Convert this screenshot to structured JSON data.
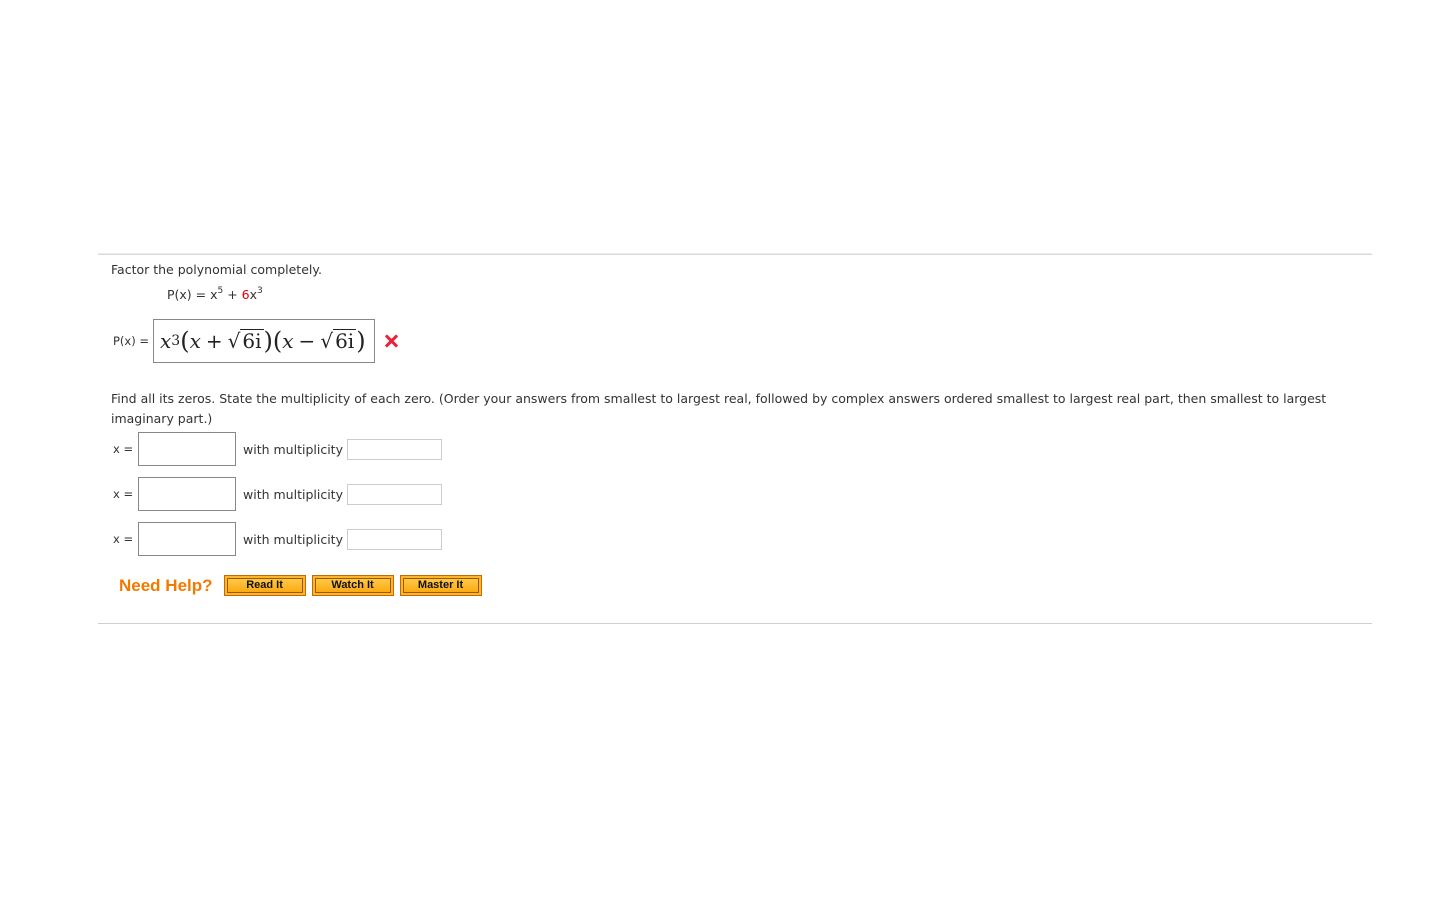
{
  "question": {
    "prompt": "Factor the polynomial completely.",
    "polynomial": {
      "lhs": "P(x) = x",
      "exp1": "5",
      "plus": " + ",
      "coef": "6",
      "var": "x",
      "exp2": "3"
    },
    "answer": {
      "label": "P(x) =",
      "x": "x",
      "x_exp": "3",
      "factor1_var": "x",
      "factor1_op": "+",
      "factor1_radicand": "6i",
      "factor2_var": "x",
      "factor2_op": "−",
      "factor2_radicand": "6i",
      "status": "incorrect",
      "status_icon": "red-x-icon"
    },
    "instructions": "Find all its zeros. State the multiplicity of each zero. (Order your answers from smallest to largest real, followed by complex answers ordered smallest to largest real part, then smallest to largest imaginary part.)",
    "zeros": [
      {
        "label": "x =",
        "value": "",
        "mult_label": "with multiplicity",
        "multiplicity": ""
      },
      {
        "label": "x =",
        "value": "",
        "mult_label": "with multiplicity",
        "multiplicity": ""
      },
      {
        "label": "x =",
        "value": "",
        "mult_label": "with multiplicity",
        "multiplicity": ""
      }
    ]
  },
  "help": {
    "label": "Need Help?",
    "buttons": [
      "Read It",
      "Watch It",
      "Master It"
    ]
  },
  "colors": {
    "accent_orange": "#f07b00",
    "button_fill": "#fdb52b",
    "error_red": "#e8233a",
    "coefficient_red": "#e00000"
  }
}
